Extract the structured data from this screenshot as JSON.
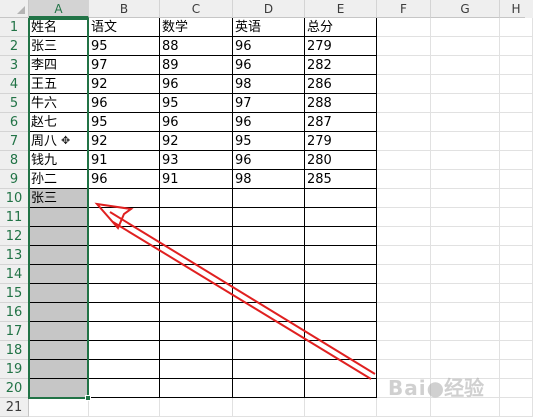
{
  "columns": [
    "A",
    "B",
    "C",
    "D",
    "E",
    "F",
    "G",
    "H"
  ],
  "rows": [
    "1",
    "2",
    "3",
    "4",
    "5",
    "6",
    "7",
    "8",
    "9",
    "10",
    "11",
    "12",
    "13",
    "14",
    "15",
    "16",
    "17",
    "18",
    "19",
    "20",
    "21"
  ],
  "selected_column": "A",
  "table": {
    "header": [
      "姓名",
      "语文",
      "数学",
      "英语",
      "总分"
    ],
    "records": [
      [
        "张三",
        "95",
        "88",
        "96",
        "279"
      ],
      [
        "李四",
        "97",
        "89",
        "96",
        "282"
      ],
      [
        "王五",
        "92",
        "96",
        "98",
        "286"
      ],
      [
        "牛六",
        "96",
        "95",
        "97",
        "288"
      ],
      [
        "赵七",
        "95",
        "96",
        "96",
        "287"
      ],
      [
        "周八",
        "92",
        "92",
        "95",
        "279"
      ],
      [
        "钱九",
        "91",
        "93",
        "96",
        "280"
      ],
      [
        "孙二",
        "96",
        "91",
        "98",
        "285"
      ]
    ],
    "extra_name": "张三"
  },
  "cursor_icon": "move-cursor-icon",
  "annotation_color": "#e02020",
  "selection_color": "#217346",
  "watermark": {
    "logo": "Baidu-logo",
    "text": "经验"
  }
}
